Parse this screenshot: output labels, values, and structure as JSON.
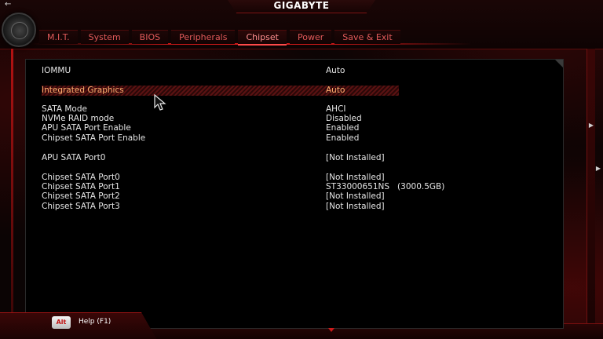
{
  "brand": "GIGABYTE",
  "tabs": [
    {
      "label": "M.I.T."
    },
    {
      "label": "System"
    },
    {
      "label": "BIOS"
    },
    {
      "label": "Peripherals"
    },
    {
      "label": "Chipset"
    },
    {
      "label": "Power"
    },
    {
      "label": "Save & Exit"
    }
  ],
  "active_tab": "Chipset",
  "settings": [
    {
      "label": "IOMMU",
      "value": "Auto"
    },
    {
      "label": "Integrated Graphics",
      "value": "Auto"
    },
    {
      "label": "SATA Mode",
      "value": "AHCI"
    },
    {
      "label": "NVMe RAID mode",
      "value": "Disabled"
    },
    {
      "label": "APU SATA Port Enable",
      "value": "Enabled"
    },
    {
      "label": "Chipset SATA Port Enable",
      "value": "Enabled"
    },
    {
      "label": "APU SATA Port0",
      "value": "[Not Installed]"
    },
    {
      "label": "Chipset SATA Port0",
      "value": "[Not Installed]"
    },
    {
      "label": "Chipset SATA Port1",
      "value": "ST33000651NS   (3000.5GB)"
    },
    {
      "label": "Chipset SATA Port2",
      "value": "[Not Installed]"
    },
    {
      "label": "Chipset SATA Port3",
      "value": "[Not Installed]"
    }
  ],
  "footer": {
    "alt_key": "Alt",
    "help": "Help (F1)"
  },
  "colors": {
    "accent": "#d01818",
    "selected_text": "#ffb070"
  },
  "icons": {
    "back": "back-arrow-icon",
    "logo": "gigabyte-eagle-logo",
    "cursor": "mouse-pointer-icon"
  }
}
